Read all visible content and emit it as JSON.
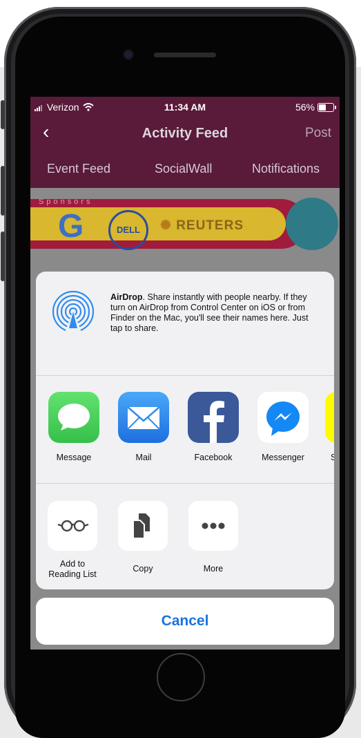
{
  "status_bar": {
    "carrier": "Verizon",
    "time": "11:34 AM",
    "battery_percent": "56%",
    "battery_level": 0.56
  },
  "nav": {
    "back_icon": "chevron-left-icon",
    "title": "Activity Feed",
    "post": "Post"
  },
  "tabs": [
    {
      "label": "Event Feed"
    },
    {
      "label": "SocialWall"
    },
    {
      "label": "Notifications"
    }
  ],
  "sponsors": {
    "label": "Sponsors",
    "logos": [
      "G",
      "DELL",
      "REUTERS"
    ]
  },
  "share_sheet": {
    "airdrop_title": "AirDrop",
    "airdrop_text": ". Share instantly with people nearby. If they turn on AirDrop from Control Center on iOS or from Finder on the Mac, you'll see their names here. Just tap to share.",
    "apps": [
      {
        "label": "Message",
        "color": "#4cd964"
      },
      {
        "label": "Mail",
        "color": "#2f8cf0"
      },
      {
        "label": "Facebook",
        "color": "#3b5998"
      },
      {
        "label": "Messenger",
        "color": "#0084ff"
      },
      {
        "label": "S",
        "color": "#fffc00"
      }
    ],
    "actions": [
      {
        "label": "Add to\nReading List",
        "icon": "glasses-icon"
      },
      {
        "label": "Copy",
        "icon": "copy-icon"
      },
      {
        "label": "More",
        "icon": "more-icon"
      }
    ]
  },
  "cancel_label": "Cancel",
  "colors": {
    "header": "#5a1a3a",
    "accent": "#1a73e0"
  }
}
